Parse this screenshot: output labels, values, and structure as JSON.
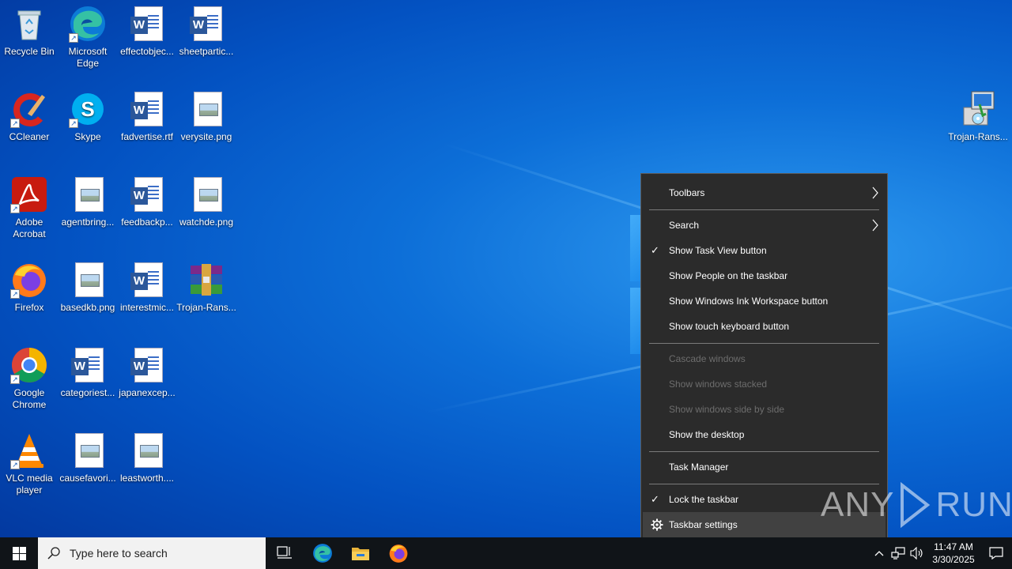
{
  "desktop": {
    "icons": [
      {
        "label": "Recycle Bin",
        "icon": "recycle-bin-icon"
      },
      {
        "label": "Microsoft Edge",
        "icon": "edge-icon"
      },
      {
        "label": "effectobjec...",
        "icon": "word-document-icon"
      },
      {
        "label": "sheetpartic...",
        "icon": "word-document-icon"
      },
      {
        "label": "CCleaner",
        "icon": "ccleaner-icon"
      },
      {
        "label": "Skype",
        "icon": "skype-icon"
      },
      {
        "label": "fadvertise.rtf",
        "icon": "word-document-icon"
      },
      {
        "label": "verysite.png",
        "icon": "image-file-icon"
      },
      {
        "label": "Adobe Acrobat",
        "icon": "acrobat-icon"
      },
      {
        "label": "agentbring...",
        "icon": "image-file-icon"
      },
      {
        "label": "feedbackp...",
        "icon": "word-document-icon"
      },
      {
        "label": "watchde.png",
        "icon": "image-file-icon"
      },
      {
        "label": "Firefox",
        "icon": "firefox-icon"
      },
      {
        "label": "basedkb.png",
        "icon": "image-file-icon"
      },
      {
        "label": "interestmic...",
        "icon": "word-document-icon"
      },
      {
        "label": "Trojan-Rans...",
        "icon": "winrar-archive-icon"
      },
      {
        "label": "Google Chrome",
        "icon": "chrome-icon"
      },
      {
        "label": "categoriest...",
        "icon": "word-document-icon"
      },
      {
        "label": "japanexcep...",
        "icon": "word-document-icon"
      },
      {
        "label": "VLC media player",
        "icon": "vlc-icon"
      },
      {
        "label": "causefavori...",
        "icon": "image-file-icon"
      },
      {
        "label": "leastworth....",
        "icon": "image-file-icon"
      },
      {
        "label": "Trojan-Rans...",
        "icon": "installer-icon"
      }
    ]
  },
  "context_menu": {
    "items": [
      {
        "label": "Toolbars",
        "submenu": true
      },
      {
        "label": "Search",
        "submenu": true
      },
      {
        "label": "Show Task View button",
        "checked": true
      },
      {
        "label": "Show People on the taskbar"
      },
      {
        "label": "Show Windows Ink Workspace button"
      },
      {
        "label": "Show touch keyboard button"
      },
      {
        "label": "Cascade windows",
        "disabled": true
      },
      {
        "label": "Show windows stacked",
        "disabled": true
      },
      {
        "label": "Show windows side by side",
        "disabled": true
      },
      {
        "label": "Show the desktop"
      },
      {
        "label": "Task Manager"
      },
      {
        "label": "Lock the taskbar",
        "checked": true
      },
      {
        "label": "Taskbar settings",
        "icon": "gear-icon",
        "highlighted": true
      }
    ]
  },
  "watermark": {
    "left": "ANY",
    "right": "RUN"
  },
  "taskbar": {
    "search_placeholder": "Type here to search",
    "pinned": [
      "task-view",
      "edge",
      "file-explorer",
      "firefox"
    ],
    "clock": {
      "time": "11:47 AM",
      "date": "3/30/2025"
    }
  },
  "colors": {
    "menu_bg": "#2b2b2b",
    "menu_hover": "#414141",
    "taskbar_bg": "#101418",
    "desktop_blue": "#0d6fd8"
  }
}
